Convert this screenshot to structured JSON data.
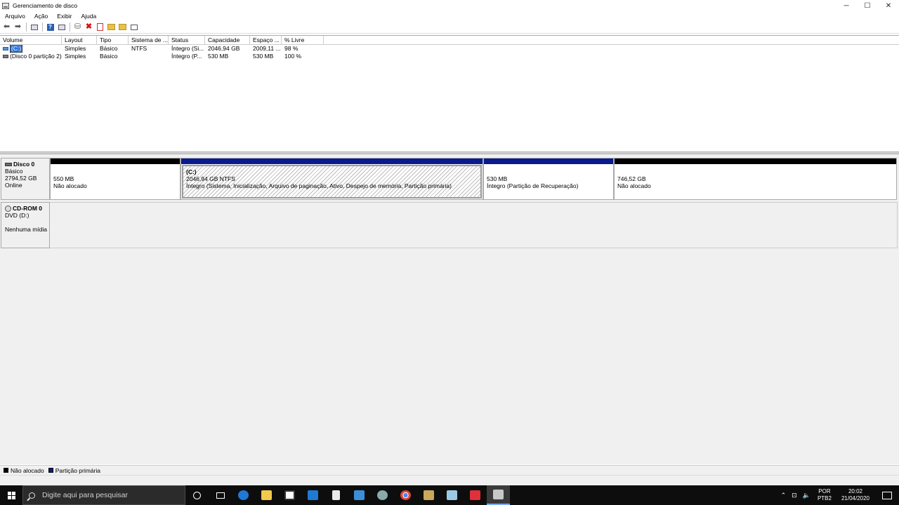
{
  "window": {
    "title": "Gerenciamento de disco",
    "controls": [
      "─",
      "☐",
      "✕"
    ]
  },
  "menu": [
    "Arquivo",
    "Ação",
    "Exibir",
    "Ajuda"
  ],
  "toolbar": {
    "icons": [
      "back-arrow-icon",
      "forward-arrow-icon",
      "console-tree-icon",
      "help-icon",
      "properties-icon",
      "connect-disk-icon",
      "delete-icon",
      "check-icon",
      "new-folder-icon",
      "folder-icon",
      "list-view-icon"
    ]
  },
  "volumes": {
    "columns": [
      "Volume",
      "Layout",
      "Tipo",
      "Sistema de ...",
      "Status",
      "Capacidade",
      "Espaço ...",
      "% Livre"
    ],
    "rows": [
      {
        "volume": "(C:)",
        "layout": "Simples",
        "tipo": "Básico",
        "fs": "NTFS",
        "status": "Íntegro (Si...",
        "capacidade": "2046,94 GB",
        "espaco": "2009,11 ...",
        "livre": "98 %"
      },
      {
        "volume": "(Disco 0 partição 2)",
        "layout": "Simples",
        "tipo": "Básico",
        "fs": "",
        "status": "Íntegro (P...",
        "capacidade": "530 MB",
        "espaco": "530 MB",
        "livre": "100 %"
      }
    ]
  },
  "disks": {
    "disk0": {
      "name": "Disco 0",
      "type": "Básico",
      "size": "2794,52 GB",
      "state": "Online",
      "partitions": [
        {
          "size": "550 MB",
          "desc": "Não alocado",
          "label": ""
        },
        {
          "label": "(C:)",
          "size": "2046,94 GB NTFS",
          "desc": "Íntegro (Sistema, Inicialização, Arquivo de paginação, Ativo, Despejo de memória, Partição primária)"
        },
        {
          "size": "530 MB",
          "desc": "Íntegro (Partição de Recuperação)",
          "label": ""
        },
        {
          "size": "746,52 GB",
          "desc": "Não alocado",
          "label": ""
        }
      ]
    },
    "cdrom0": {
      "name": "CD-ROM 0",
      "drive": "DVD (D:)",
      "media": "Nenhuma mídia"
    }
  },
  "legend": [
    {
      "label": "Não alocado",
      "color": "#000000"
    },
    {
      "label": "Partição primária",
      "color": "#0a1a8c"
    }
  ],
  "taskbar": {
    "search_placeholder": "Digite aqui para pesquisar",
    "apps": [
      "cortana-icon",
      "task-view-icon",
      "edge-icon",
      "file-explorer-icon",
      "store-icon",
      "mail-icon",
      "calculator-icon",
      "remote-desktop-icon",
      "app-icon",
      "chrome-icon",
      "scanner-icon",
      "notes-icon",
      "game-icon",
      "disk-management-icon"
    ],
    "lang_top": "POR",
    "lang_bottom": "PTB2",
    "time": "20:02",
    "date": "21/04/2020"
  }
}
